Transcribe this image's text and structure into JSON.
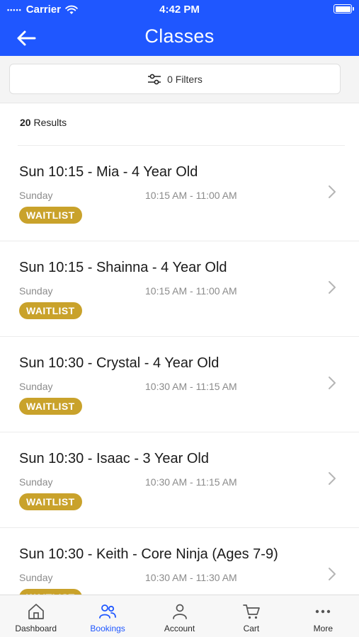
{
  "status_bar": {
    "carrier": "Carrier",
    "time": "4:42 PM"
  },
  "nav": {
    "title": "Classes",
    "back_icon": "arrow-left-icon"
  },
  "filters": {
    "label": "0 Filters",
    "icon": "sliders-icon"
  },
  "results": {
    "count": "20",
    "label": "Results"
  },
  "classes": [
    {
      "title": "Sun 10:15 - Mia - 4 Year Old",
      "day": "Sunday",
      "time": "10:15 AM - 11:00 AM",
      "badge": "WAITLIST"
    },
    {
      "title": "Sun 10:15 - Shainna - 4 Year Old",
      "day": "Sunday",
      "time": "10:15 AM - 11:00 AM",
      "badge": "WAITLIST"
    },
    {
      "title": "Sun 10:30 - Crystal - 4 Year Old",
      "day": "Sunday",
      "time": "10:30 AM - 11:15 AM",
      "badge": "WAITLIST"
    },
    {
      "title": "Sun 10:30 - Isaac - 3 Year Old",
      "day": "Sunday",
      "time": "10:30 AM - 11:15 AM",
      "badge": "WAITLIST"
    },
    {
      "title": "Sun 10:30 - Keith - Core Ninja (Ages 7-9)",
      "day": "Sunday",
      "time": "10:30 AM - 11:30 AM",
      "badge": "WAITLIST"
    }
  ],
  "tabbar": {
    "items": [
      {
        "label": "Dashboard",
        "icon": "home-icon",
        "active": false
      },
      {
        "label": "Bookings",
        "icon": "people-icon",
        "active": true
      },
      {
        "label": "Account",
        "icon": "person-icon",
        "active": false
      },
      {
        "label": "Cart",
        "icon": "cart-icon",
        "active": false
      },
      {
        "label": "More",
        "icon": "more-dots-icon",
        "active": false
      }
    ]
  },
  "colors": {
    "header": "#1f57ff",
    "badge": "#c9a22b",
    "active_tab": "#1f57ff"
  }
}
